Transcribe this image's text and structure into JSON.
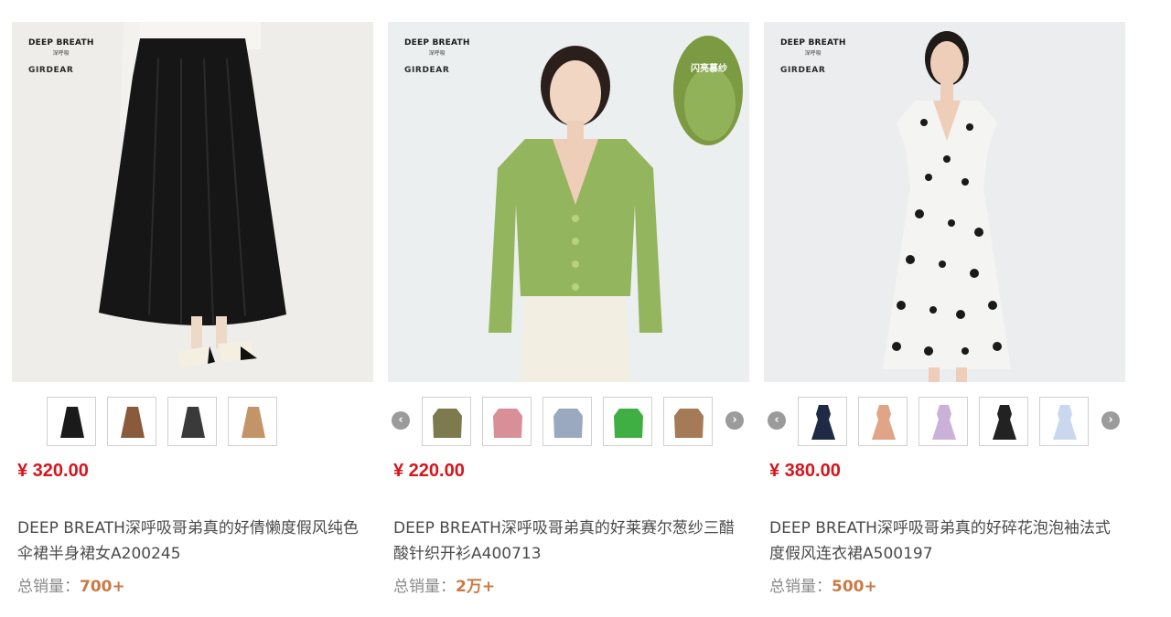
{
  "products": [
    {
      "brand_line1": "DEEP BREATH",
      "brand_line2": "深呼吸",
      "brand_line3": "GIRDEAR",
      "price": "¥ 320.00",
      "title": "DEEP BREATH深呼吸哥弟真的好倩懒度假风纯色伞裙半身裙女A200245",
      "sales_label": "总销量：",
      "sales_value": "700+",
      "swatches": [
        "#1a1a1a",
        "#8a5a3c",
        "#3a3a3a",
        "#c39468"
      ],
      "has_arrows": false
    },
    {
      "brand_line1": "DEEP BREATH",
      "brand_line2": "深呼吸",
      "brand_line3": "GIRDEAR",
      "badge": "闪亮慕纱",
      "price": "¥ 220.00",
      "title": "DEEP BREATH深呼吸哥弟真的好莱赛尔葱纱三醋酸针织开衫A400713",
      "sales_label": "总销量：",
      "sales_value": "2万+",
      "swatches": [
        "#7d7a4e",
        "#d88f98",
        "#9aa8c0",
        "#3fae43",
        "#a57a56"
      ],
      "has_arrows": true
    },
    {
      "brand_line1": "DEEP BREATH",
      "brand_line2": "深呼吸",
      "brand_line3": "GIRDEAR",
      "price": "¥ 380.00",
      "title": "DEEP BREATH深呼吸哥弟真的好碎花泡泡袖法式度假风连衣裙A500197",
      "sales_label": "总销量：",
      "sales_value": "500+",
      "swatches": [
        "#1f2a44",
        "#e0a587",
        "#c9b1d8",
        "#222222",
        "#c9d8ee"
      ],
      "has_arrows": true
    }
  ],
  "icons": {
    "prev": "chevron-left-icon",
    "next": "chevron-right-icon"
  },
  "colors": {
    "price": "#d8151b",
    "sales_value": "#c97a45"
  },
  "arrow_glyphs": {
    "prev": "‹",
    "next": "›"
  }
}
